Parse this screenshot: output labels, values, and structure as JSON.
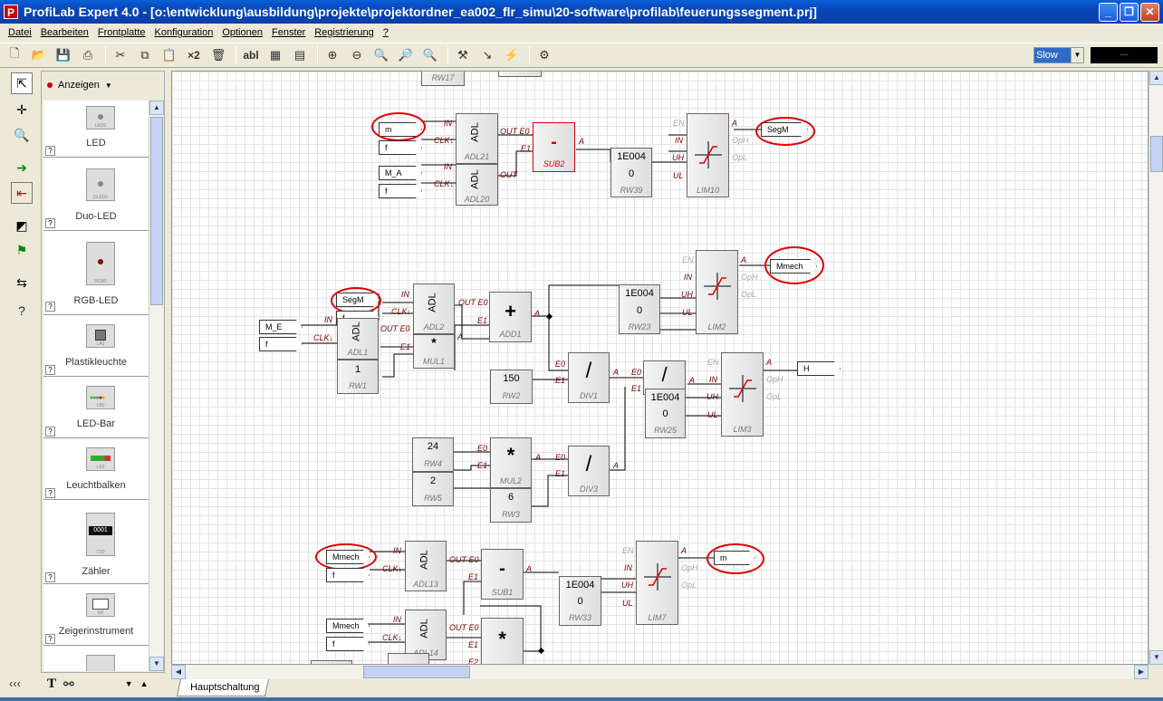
{
  "window": {
    "title": "ProfiLab Expert 4.0 - [o:\\entwicklung\\ausbildung\\projekte\\projektordner_ea002_flr_simu\\20-software\\profilab\\feuerungssegment.prj]",
    "app_icon_letter": "P"
  },
  "menu": [
    "Datei",
    "Bearbeiten",
    "Frontplatte",
    "Konfiguration",
    "Optionen",
    "Fenster",
    "Registrierung",
    "?"
  ],
  "toolbar": {
    "times2_label": "×2",
    "text_label": "abl",
    "speed_value": "Slow",
    "lcd_value": "---"
  },
  "panel": {
    "dropdown_label": "Anzeigen",
    "components": [
      {
        "label": "LED",
        "tag": "LED0"
      },
      {
        "label": "Duo-LED",
        "tag": "DLED0"
      },
      {
        "label": "RGB-LED",
        "tag": "RGB0"
      },
      {
        "label": "Plastikleuchte",
        "tag": "LA0"
      },
      {
        "label": "LED-Bar",
        "tag": "LB0"
      },
      {
        "label": "Leuchtbalken",
        "tag": "LE0"
      },
      {
        "label": "Zähler",
        "tag": "C00"
      },
      {
        "label": "Zeigerinstrument",
        "tag": "M0"
      }
    ]
  },
  "bottom_left": {
    "collapse_label": "‹‹‹"
  },
  "tabs": {
    "active": "Hauptschaltung"
  },
  "circuit": {
    "blocks": {
      "adl21": {
        "type": "ADL",
        "name": "ADL21"
      },
      "adl20": {
        "type": "ADL",
        "name": "ADL20"
      },
      "sub2": {
        "op": "-",
        "name": "SUB2"
      },
      "rw39": {
        "v1": "1E004",
        "v2": "0",
        "name": "RW39"
      },
      "lim10": {
        "name": "LIM10"
      },
      "adl2": {
        "type": "ADL",
        "name": "ADL2"
      },
      "adl1": {
        "type": "ADL",
        "name": "ADL1"
      },
      "mul1": {
        "op": "*",
        "name": "MUL1"
      },
      "rw1": {
        "v": "1",
        "name": "RW1"
      },
      "add1": {
        "op": "+",
        "name": "ADD1"
      },
      "rw23": {
        "v1": "1E004",
        "v2": "0",
        "name": "RW23"
      },
      "lim2": {
        "name": "LIM2"
      },
      "rw2": {
        "v": "150",
        "name": "RW2"
      },
      "div1": {
        "op": "/",
        "name": "DIV1"
      },
      "div2": {
        "op": "/"
      },
      "rw25": {
        "v1": "1E004",
        "v2": "0",
        "name": "RW25"
      },
      "lim3": {
        "name": "LIM3"
      },
      "rw4": {
        "v": "24",
        "name": "RW4"
      },
      "rw5": {
        "v": "2",
        "name": "RW5"
      },
      "mul2": {
        "op": "*",
        "name": "MUL2"
      },
      "rw3": {
        "v": "6",
        "name": "RW3"
      },
      "div3": {
        "op": "/",
        "name": "DIV3"
      },
      "adl13": {
        "type": "ADL",
        "name": "ADL13"
      },
      "sub1": {
        "op": "-",
        "name": "SUB1"
      },
      "rw33": {
        "v1": "1E004",
        "v2": "0",
        "name": "RW33"
      },
      "lim7": {
        "name": "LIM7"
      },
      "adl14": {
        "type": "ADL",
        "name": "ADL14"
      },
      "mul3": {
        "op": "*"
      },
      "rw17": {
        "name": "RW17"
      },
      "div_top": {
        "name": "DIV1"
      }
    },
    "signals": {
      "m_in": "m",
      "f1": "f",
      "m_a": "M_A",
      "f2": "f",
      "segm_out": "SegM",
      "segm_in": "SegM",
      "f3": "f",
      "m_e": "M_E",
      "f4": "f",
      "mmech_out": "Mmech",
      "h_out": "H",
      "mmech_in": "Mmech",
      "f5": "f",
      "m_out": "m",
      "mmech_in2": "Mmech",
      "f6": "f"
    },
    "pins": {
      "in": "IN",
      "clk": "CLK↓",
      "out_e0": "OUT E0",
      "out": "OUT",
      "e0": "E0",
      "e1": "E1",
      "e2": "E2",
      "a": "A",
      "en": "EN",
      "uh": "UH",
      "ul": "UL",
      "oph": "OpH",
      "opl": "OpL"
    }
  }
}
